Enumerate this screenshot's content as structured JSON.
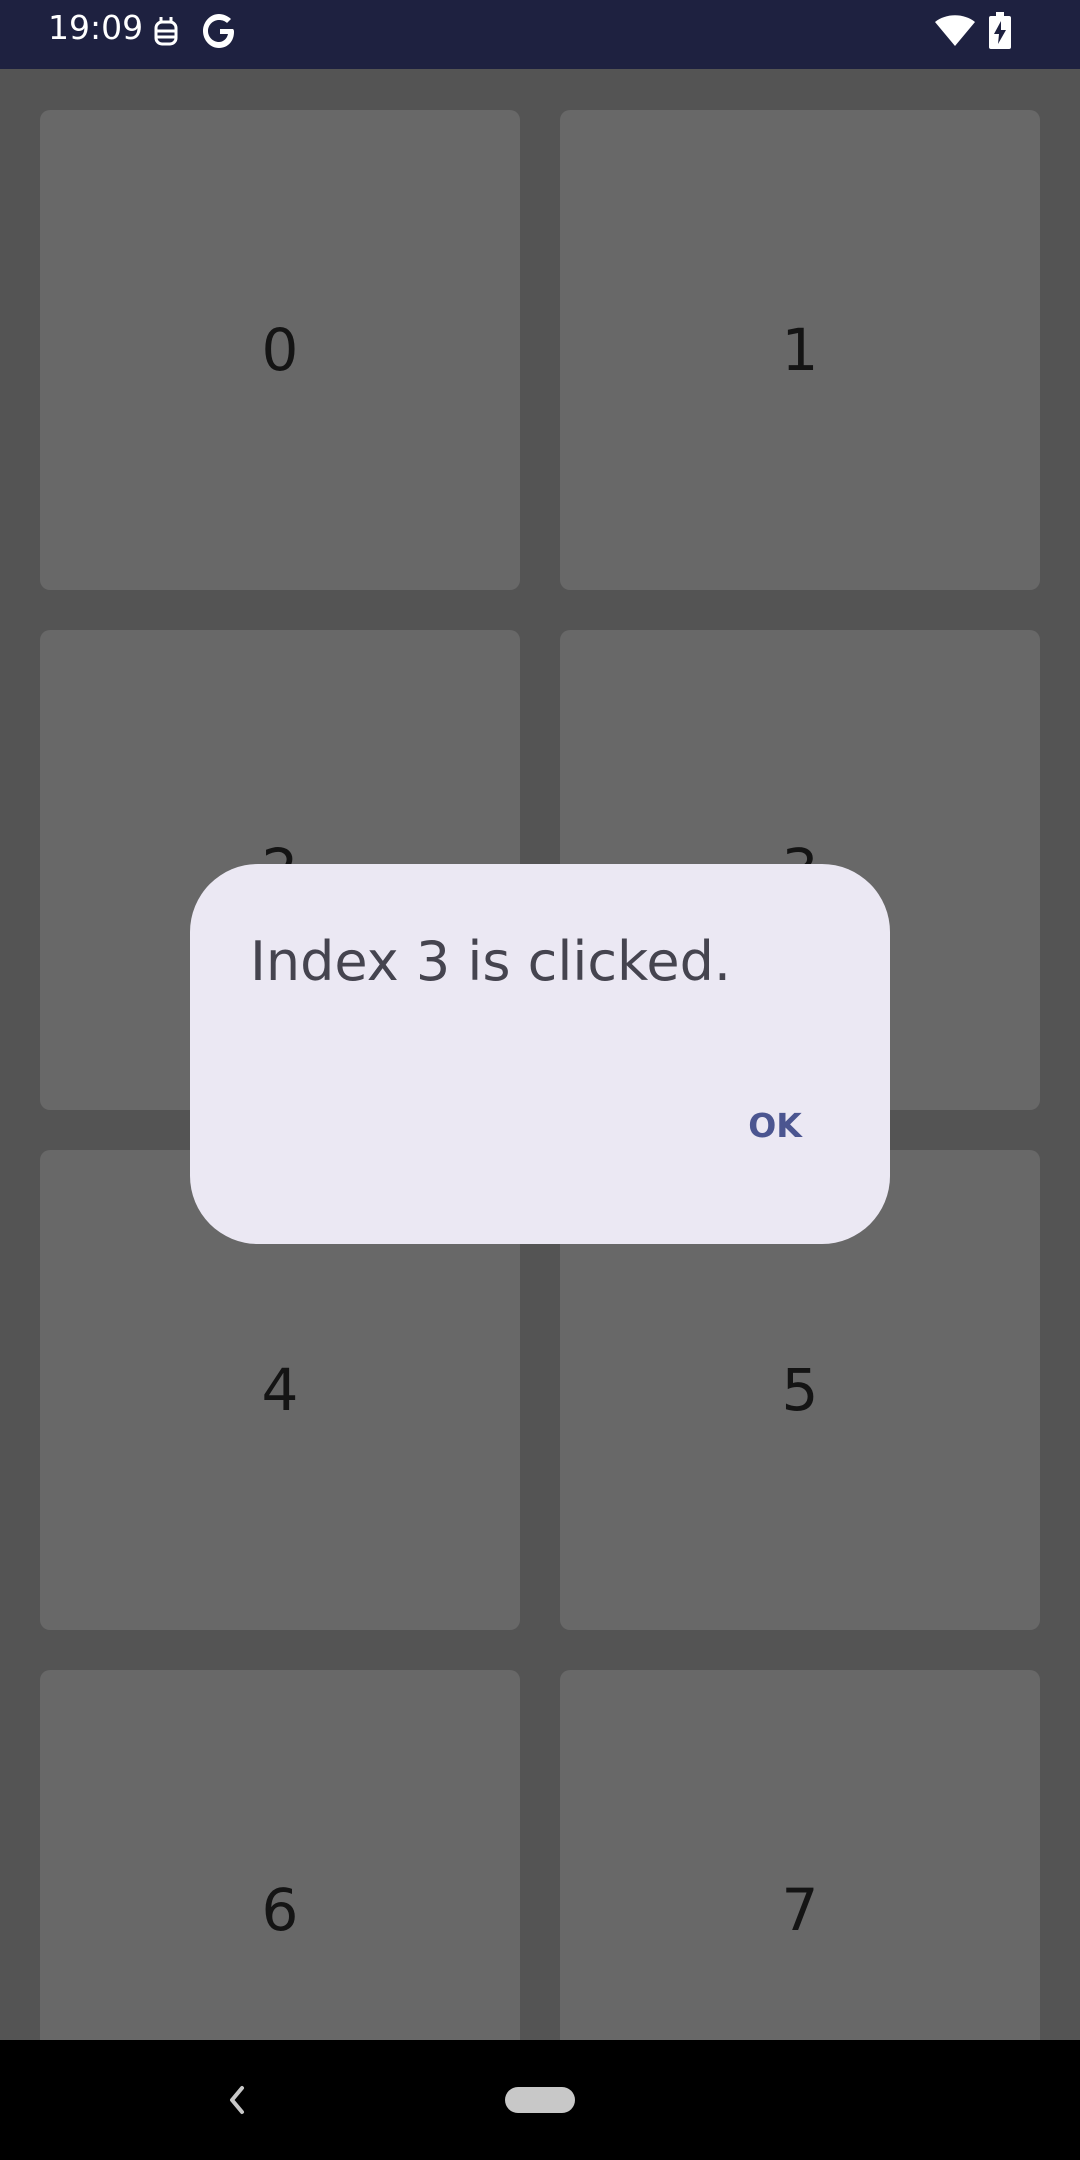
{
  "status_bar": {
    "time": "19:09",
    "icons": [
      "notification-robot-icon",
      "google-g-icon",
      "wifi-icon",
      "battery-charging-icon"
    ]
  },
  "grid": {
    "cells": [
      {
        "label": "0"
      },
      {
        "label": "1"
      },
      {
        "label": "2"
      },
      {
        "label": "3"
      },
      {
        "label": "4"
      },
      {
        "label": "5"
      },
      {
        "label": "6"
      },
      {
        "label": "7"
      }
    ]
  },
  "dialog": {
    "message": "Index 3 is clicked.",
    "ok_label": "OK"
  },
  "nav_bar": {
    "icons": [
      "back-icon",
      "home-pill-icon"
    ]
  },
  "colors": {
    "status_bar_bg": "#1e2140",
    "grid_bg": "#545454",
    "cell_bg": "#686868",
    "dialog_bg": "#ebe8f3",
    "accent": "#4b5590"
  }
}
